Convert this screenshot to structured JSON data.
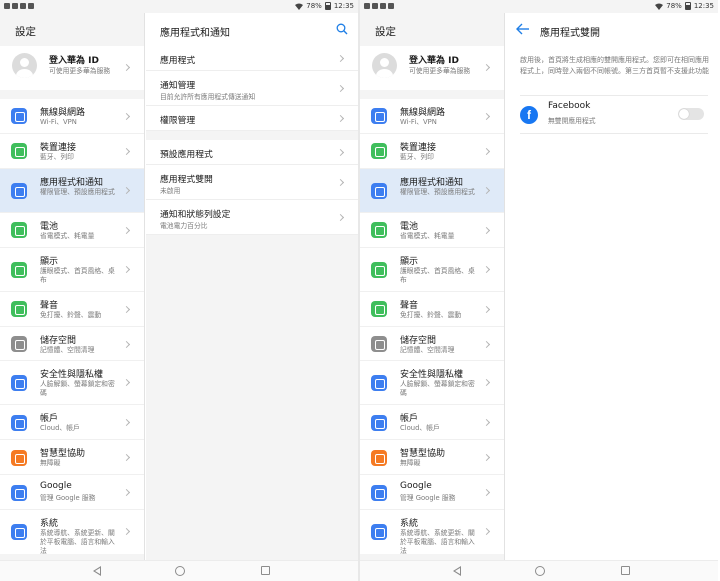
{
  "status_bar": {
    "battery": "78%",
    "time": "12:35"
  },
  "settings": {
    "title": "設定",
    "account": {
      "title": "登入華為 ID",
      "subtitle": "可使用更多華為服務"
    },
    "items": [
      {
        "title": "無線與網路",
        "subtitle": "Wi-Fi、VPN",
        "icon": "wifi-icon",
        "color": "#3d7ef0"
      },
      {
        "title": "裝置連接",
        "subtitle": "藍牙、列印",
        "icon": "device-connect-icon",
        "color": "#3fbe5c"
      },
      {
        "title": "應用程式和通知",
        "subtitle": "權限管理、預設應用程式",
        "icon": "apps-icon",
        "color": "#3d7ef0"
      },
      {
        "title": "電池",
        "subtitle": "省電模式、耗電量",
        "icon": "battery-icon",
        "color": "#3fbe5c"
      },
      {
        "title": "顯示",
        "subtitle": "護眼模式、首頁風格、桌布",
        "icon": "display-icon",
        "color": "#3fbe5c"
      },
      {
        "title": "聲音",
        "subtitle": "免打擾、鈴聲、震動",
        "icon": "sound-icon",
        "color": "#3fbe5c"
      },
      {
        "title": "儲存空間",
        "subtitle": "記憶體、空間清理",
        "icon": "storage-icon",
        "color": "#8e8e8e"
      },
      {
        "title": "安全性與隱私權",
        "subtitle": "人臉解鎖、螢幕鎖定和密碼",
        "icon": "security-icon",
        "color": "#3d7ef0"
      },
      {
        "title": "帳戶",
        "subtitle": "Cloud、帳戶",
        "icon": "account-icon",
        "color": "#3d7ef0"
      },
      {
        "title": "智慧型協助",
        "subtitle": "無障礙",
        "icon": "assist-icon",
        "color": "#f57a23"
      },
      {
        "title": "Google",
        "subtitle": "管理 Google 服務",
        "icon": "google-icon",
        "color": "#3d7ef0"
      },
      {
        "title": "系統",
        "subtitle": "系統導航、系統更新、關於平板電腦、語言和輸入法",
        "icon": "system-icon",
        "color": "#3d7ef0"
      }
    ]
  },
  "apps_panel": {
    "title": "應用程式和通知",
    "items": [
      {
        "title": "應用程式",
        "subtitle": ""
      },
      {
        "title": "通知管理",
        "subtitle": "目前允許所有應用程式傳送通知"
      },
      {
        "title": "權限管理",
        "subtitle": ""
      },
      {
        "title": "預設應用程式",
        "subtitle": ""
      },
      {
        "title": "應用程式雙開",
        "subtitle": "未啟用"
      },
      {
        "title": "通知和狀態列設定",
        "subtitle": "電池電力百分比"
      }
    ]
  },
  "twin_panel": {
    "title": "應用程式雙開",
    "description": "啟用後，首頁將生成相應的雙開應用程式。您即可在相同應用程式上，同時登入兩個不同帳號。第三方首頁暫不支援此功能",
    "app": {
      "name": "Facebook",
      "status": "無雙開應用程式",
      "enabled": false
    }
  },
  "colors": {
    "accent": "#1e7ee6",
    "selected_bg": "#dfeaf8",
    "page_bg": "#f4f4f4"
  }
}
